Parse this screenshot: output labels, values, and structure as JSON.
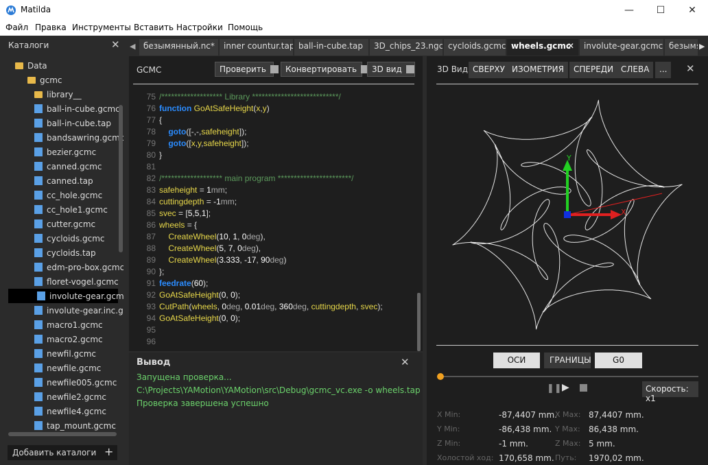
{
  "window": {
    "title": "Matilda",
    "minimize": "—",
    "maximize": "☐",
    "close": "✕"
  },
  "menu": [
    "Файл",
    "Правка",
    "Инструменты",
    "Вставить",
    "Настройки",
    "Помощь"
  ],
  "catalog": {
    "title": "Каталоги",
    "close": "✕",
    "tree": [
      {
        "label": "Data",
        "type": "folder",
        "level": 0
      },
      {
        "label": "gcmc",
        "type": "folder",
        "level": 1
      },
      {
        "label": "library__",
        "type": "folder",
        "level": 2
      },
      {
        "label": "ball-in-cube.gcmc",
        "type": "file",
        "level": 2
      },
      {
        "label": "ball-in-cube.tap",
        "type": "file",
        "level": 2
      },
      {
        "label": "bandsawring.gcmc",
        "type": "file",
        "level": 2
      },
      {
        "label": "bezier.gcmc",
        "type": "file",
        "level": 2
      },
      {
        "label": "canned.gcmc",
        "type": "file",
        "level": 2
      },
      {
        "label": "canned.tap",
        "type": "file",
        "level": 2
      },
      {
        "label": "cc_hole.gcmc",
        "type": "file",
        "level": 2
      },
      {
        "label": "cc_hole1.gcmc",
        "type": "file",
        "level": 2
      },
      {
        "label": "cutter.gcmc",
        "type": "file",
        "level": 2
      },
      {
        "label": "cycloids.gcmc",
        "type": "file",
        "level": 2
      },
      {
        "label": "cycloids.tap",
        "type": "file",
        "level": 2
      },
      {
        "label": "edm-pro-box.gcmc",
        "type": "file",
        "level": 2
      },
      {
        "label": "floret-vogel.gcmc",
        "type": "file",
        "level": 2
      },
      {
        "label": "involute-gear.gcmc",
        "type": "file",
        "level": 2,
        "selected": true
      },
      {
        "label": "involute-gear.inc.gcmc",
        "type": "file",
        "level": 2
      },
      {
        "label": "macro1.gcmc",
        "type": "file",
        "level": 2
      },
      {
        "label": "macro2.gcmc",
        "type": "file",
        "level": 2
      },
      {
        "label": "newfil.gcmc",
        "type": "file",
        "level": 2
      },
      {
        "label": "newfile.gcmc",
        "type": "file",
        "level": 2
      },
      {
        "label": "newfile005.gcmc",
        "type": "file",
        "level": 2
      },
      {
        "label": "newfile2.gcmc",
        "type": "file",
        "level": 2
      },
      {
        "label": "newfile4.gcmc",
        "type": "file",
        "level": 2
      },
      {
        "label": "tap_mount.gcmc",
        "type": "file",
        "level": 2
      }
    ],
    "add_label": "Добавить каталоги",
    "add_icon": "+"
  },
  "tabs": [
    {
      "label": "безымянный.nc*"
    },
    {
      "label": "inner countur.tap*"
    },
    {
      "label": "ball-in-cube.tap"
    },
    {
      "label": "3D_chips_23.ngc"
    },
    {
      "label": "cycloids.gcmc"
    },
    {
      "label": "wheels.gcmc",
      "active": true,
      "close": "✕"
    },
    {
      "label": "involute-gear.gcmc"
    },
    {
      "label": "безымя"
    }
  ],
  "editor": {
    "title": "GCMC",
    "check_label": "Проверить",
    "convert_label": "Конвертировать",
    "view3d_label": "3D вид",
    "lines": [
      {
        "n": "75",
        "tokens": [
          {
            "c": "cm",
            "t": "/******************* Library ***************************/"
          }
        ]
      },
      {
        "n": "76",
        "tokens": [
          {
            "c": "kw",
            "t": "function "
          },
          {
            "c": "fn",
            "t": "GoAtSafeHeight"
          },
          {
            "c": "p",
            "t": "("
          },
          {
            "c": "id",
            "t": "x"
          },
          {
            "c": "p",
            "t": ","
          },
          {
            "c": "id",
            "t": "y"
          },
          {
            "c": "p",
            "t": ")"
          }
        ]
      },
      {
        "n": "77",
        "tokens": [
          {
            "c": "p",
            "t": "{"
          }
        ]
      },
      {
        "n": "78",
        "tokens": [
          {
            "c": "p",
            "t": "    "
          },
          {
            "c": "kw",
            "t": "goto"
          },
          {
            "c": "p",
            "t": "([-,-,"
          },
          {
            "c": "id",
            "t": "safeheight"
          },
          {
            "c": "p",
            "t": "]);"
          }
        ]
      },
      {
        "n": "79",
        "tokens": [
          {
            "c": "p",
            "t": "    "
          },
          {
            "c": "kw",
            "t": "goto"
          },
          {
            "c": "p",
            "t": "(["
          },
          {
            "c": "id",
            "t": "x"
          },
          {
            "c": "p",
            "t": ","
          },
          {
            "c": "id",
            "t": "y"
          },
          {
            "c": "p",
            "t": ","
          },
          {
            "c": "id",
            "t": "safeheight"
          },
          {
            "c": "p",
            "t": "]);"
          }
        ]
      },
      {
        "n": "80",
        "tokens": [
          {
            "c": "p",
            "t": "}"
          }
        ]
      },
      {
        "n": "81",
        "tokens": []
      },
      {
        "n": "82",
        "tokens": [
          {
            "c": "cm",
            "t": "/******************* main program ***********************/"
          }
        ]
      },
      {
        "n": "83",
        "tokens": [
          {
            "c": "id",
            "t": "safeheight"
          },
          {
            "c": "p",
            "t": " = "
          },
          {
            "c": "nm",
            "t": "1"
          },
          {
            "c": "un",
            "t": "mm"
          },
          {
            "c": "p",
            "t": ";"
          }
        ]
      },
      {
        "n": "84",
        "tokens": [
          {
            "c": "id",
            "t": "cuttingdepth"
          },
          {
            "c": "p",
            "t": " = "
          },
          {
            "c": "nm",
            "t": "-1"
          },
          {
            "c": "un",
            "t": "mm"
          },
          {
            "c": "p",
            "t": ";"
          }
        ]
      },
      {
        "n": "85",
        "tokens": [
          {
            "c": "id",
            "t": "svec"
          },
          {
            "c": "p",
            "t": " = ["
          },
          {
            "c": "nm",
            "t": "5"
          },
          {
            "c": "p",
            "t": ","
          },
          {
            "c": "nm",
            "t": "5"
          },
          {
            "c": "p",
            "t": ","
          },
          {
            "c": "nm",
            "t": "1"
          },
          {
            "c": "p",
            "t": "];"
          }
        ]
      },
      {
        "n": "86",
        "tokens": [
          {
            "c": "id",
            "t": "wheels"
          },
          {
            "c": "p",
            "t": " = {"
          }
        ]
      },
      {
        "n": "87",
        "tokens": [
          {
            "c": "p",
            "t": "    "
          },
          {
            "c": "fn",
            "t": "CreateWheel"
          },
          {
            "c": "p",
            "t": "("
          },
          {
            "c": "nm",
            "t": "10"
          },
          {
            "c": "p",
            "t": ", "
          },
          {
            "c": "nm",
            "t": "1"
          },
          {
            "c": "p",
            "t": ", "
          },
          {
            "c": "nm",
            "t": "0"
          },
          {
            "c": "un",
            "t": "deg"
          },
          {
            "c": "p",
            "t": "),"
          }
        ]
      },
      {
        "n": "88",
        "tokens": [
          {
            "c": "p",
            "t": "    "
          },
          {
            "c": "fn",
            "t": "CreateWheel"
          },
          {
            "c": "p",
            "t": "("
          },
          {
            "c": "nm",
            "t": "5"
          },
          {
            "c": "p",
            "t": ", "
          },
          {
            "c": "nm",
            "t": "7"
          },
          {
            "c": "p",
            "t": ", "
          },
          {
            "c": "nm",
            "t": "0"
          },
          {
            "c": "un",
            "t": "deg"
          },
          {
            "c": "p",
            "t": "),"
          }
        ]
      },
      {
        "n": "89",
        "tokens": [
          {
            "c": "p",
            "t": "    "
          },
          {
            "c": "fn",
            "t": "CreateWheel"
          },
          {
            "c": "p",
            "t": "("
          },
          {
            "c": "nm",
            "t": "3.333"
          },
          {
            "c": "p",
            "t": ", "
          },
          {
            "c": "nm",
            "t": "-17"
          },
          {
            "c": "p",
            "t": ", "
          },
          {
            "c": "nm",
            "t": "90"
          },
          {
            "c": "un",
            "t": "deg"
          },
          {
            "c": "p",
            "t": ")"
          }
        ]
      },
      {
        "n": "90",
        "tokens": [
          {
            "c": "p",
            "t": "};"
          }
        ]
      },
      {
        "n": "91",
        "tokens": [
          {
            "c": "kw",
            "t": "feedrate"
          },
          {
            "c": "p",
            "t": "("
          },
          {
            "c": "nm",
            "t": "60"
          },
          {
            "c": "p",
            "t": ");"
          }
        ]
      },
      {
        "n": "92",
        "tokens": [
          {
            "c": "fn",
            "t": "GoAtSafeHeight"
          },
          {
            "c": "p",
            "t": "("
          },
          {
            "c": "nm",
            "t": "0"
          },
          {
            "c": "p",
            "t": ", "
          },
          {
            "c": "nm",
            "t": "0"
          },
          {
            "c": "p",
            "t": ");"
          }
        ]
      },
      {
        "n": "93",
        "tokens": [
          {
            "c": "fn",
            "t": "CutPath"
          },
          {
            "c": "p",
            "t": "("
          },
          {
            "c": "id",
            "t": "wheels"
          },
          {
            "c": "p",
            "t": ", "
          },
          {
            "c": "nm",
            "t": "0"
          },
          {
            "c": "un",
            "t": "deg"
          },
          {
            "c": "p",
            "t": ", "
          },
          {
            "c": "nm",
            "t": "0.01"
          },
          {
            "c": "un",
            "t": "deg"
          },
          {
            "c": "p",
            "t": ", "
          },
          {
            "c": "nm",
            "t": "360"
          },
          {
            "c": "un",
            "t": "deg"
          },
          {
            "c": "p",
            "t": ", "
          },
          {
            "c": "id",
            "t": "cuttingdepth"
          },
          {
            "c": "p",
            "t": ", "
          },
          {
            "c": "id",
            "t": "svec"
          },
          {
            "c": "p",
            "t": ");"
          }
        ]
      },
      {
        "n": "94",
        "tokens": [
          {
            "c": "fn",
            "t": "GoAtSafeHeight"
          },
          {
            "c": "p",
            "t": "("
          },
          {
            "c": "nm",
            "t": "0"
          },
          {
            "c": "p",
            "t": ", "
          },
          {
            "c": "nm",
            "t": "0"
          },
          {
            "c": "p",
            "t": ");"
          }
        ]
      },
      {
        "n": "95",
        "tokens": []
      },
      {
        "n": "96",
        "tokens": []
      }
    ]
  },
  "output": {
    "title": "Вывод",
    "close": "✕",
    "lines": [
      "Запущена проверка...",
      "C:\\Projects\\YAMotion\\YAMotion\\src\\Debug\\gcmc_vc.exe -o wheels.tap -q --in",
      "Проверка завершена успешно"
    ]
  },
  "view3d": {
    "label": "3D Вид:",
    "buttons": [
      "СВЕРХУ",
      "ИЗОМЕТРИЯ",
      "СПЕРЕДИ",
      "СЛЕВА",
      "..."
    ],
    "close": "✕",
    "axis_y": "Y",
    "axis_x": "X",
    "toggles": [
      "ОСИ",
      "ГРАНИЦЫ",
      "G0"
    ],
    "speed_label": "Скорость: x1",
    "progress": 0.0,
    "stats": [
      {
        "label": "X Min:",
        "value": "-87,4407 mm."
      },
      {
        "label": "X Max:",
        "value": "87,4407 mm."
      },
      {
        "label": "Y Min:",
        "value": "-86,438 mm."
      },
      {
        "label": "Y Max:",
        "value": "86,438 mm."
      },
      {
        "label": "Z Min:",
        "value": "-1 mm."
      },
      {
        "label": "Z Max:",
        "value": "5 mm."
      },
      {
        "label": "Холостой ход:",
        "value": "170,658 mm."
      },
      {
        "label": "Путь:",
        "value": "1970,02 mm."
      }
    ]
  }
}
